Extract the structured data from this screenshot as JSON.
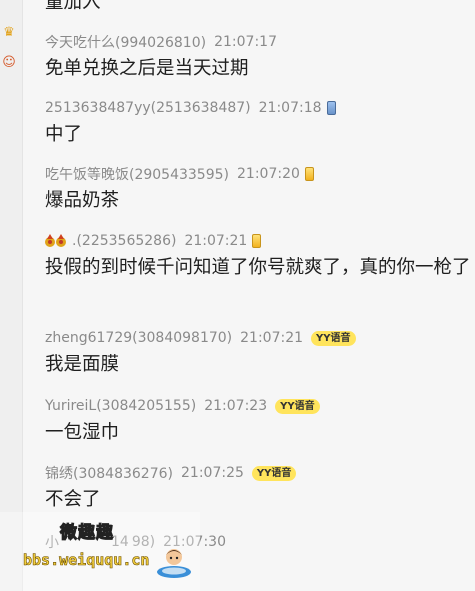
{
  "messages": [
    {
      "sender": "",
      "time": "",
      "text": "量加入",
      "badge": null
    },
    {
      "sender": "今天吃什么(994026810)",
      "time": "21:07:17",
      "text": "免单兑换之后是当天过期",
      "badge": null
    },
    {
      "sender": "2513638487yy(2513638487)",
      "time": "21:07:18",
      "text": "中了",
      "badge": "phone"
    },
    {
      "sender": "吃午饭等晚饭(2905433595)",
      "time": "21:07:20",
      "text": "爆品奶茶",
      "badge": "phone-gold"
    },
    {
      "sender": ".(2253565286)",
      "time": "21:07:21",
      "text": "投假的到时候千问知道了你号就爽了，真的你一枪了",
      "badge": "phone-gold"
    },
    {
      "sender": "zheng61729(3084098170)",
      "time": "21:07:21",
      "text": "我是面膜",
      "badge": "yy"
    },
    {
      "sender": "YurireiL(3084205155)",
      "time": "21:07:23",
      "text": "一包湿巾",
      "badge": "yy"
    },
    {
      "sender": "锦绣(3084836276)",
      "time": "21:07:25",
      "text": "不会了",
      "badge": "yy"
    },
    {
      "sender": "小",
      "sender_tail": "14",
      "sender_tail2": "98)",
      "time": "21:07:30",
      "text": "",
      "badge": null
    }
  ],
  "badges": {
    "yy_label": "YY语音"
  },
  "watermark": {
    "title": "微趣趣",
    "url": "bbs.weiququ.cn"
  },
  "colors": {
    "background": "#f6f6f6",
    "meta": "#8a8a8a",
    "text": "#1f1f1f",
    "yy_badge": "#ffe45c"
  }
}
